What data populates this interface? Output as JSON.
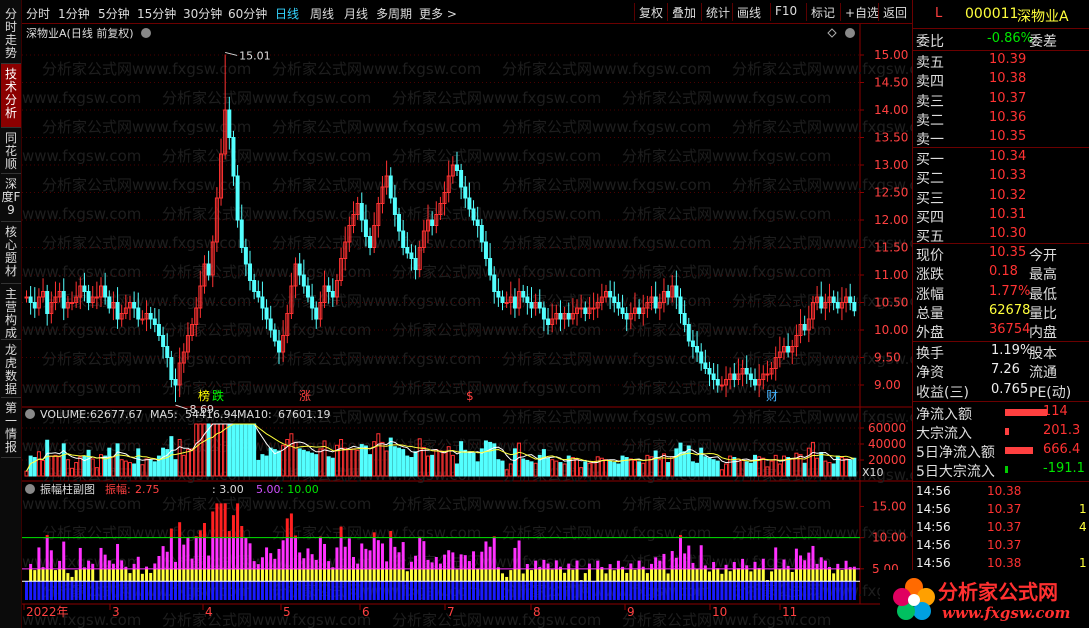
{
  "nav": [
    "分时走势",
    "技术分析",
    "同花顺",
    "深度F9",
    "核心题材",
    "主营构成",
    "龙虎数据",
    "第一情报"
  ],
  "toolbar": {
    "periods": [
      "分时",
      "1分钟",
      "5分钟",
      "15分钟",
      "30分钟",
      "60分钟",
      "日线",
      "周线",
      "月线",
      "多周期",
      "更多 >"
    ],
    "active_period": "日线",
    "right_buttons": [
      "复权",
      "叠加",
      "统计",
      "画线",
      "F10",
      "标记",
      "+自选",
      "返回"
    ]
  },
  "main": {
    "title": "深物业A(日线 前复权)",
    "high_label": "15.01",
    "low_label": "8.69",
    "markers": [
      {
        "text": "榜",
        "color": "#ffff00"
      },
      {
        "text": "跌",
        "color": "#00ff00"
      },
      {
        "text": "涨",
        "color": "#ff4040"
      },
      {
        "text": "$",
        "color": "#ff4040"
      },
      {
        "text": "财",
        "color": "#46b4ff"
      }
    ],
    "y_labels": [
      "15.00",
      "14.50",
      "14.00",
      "13.50",
      "13.00",
      "12.50",
      "12.00",
      "11.50",
      "11.00",
      "10.50",
      "10.00",
      "9.50",
      "9.00"
    ]
  },
  "volume": {
    "label": "VOLUME:",
    "value": "62677.67",
    "ma5_label": "MA5:",
    "ma5": "54416.94",
    "ma10_label": "MA10:",
    "ma10": "67601.19",
    "y_labels": [
      "60000",
      "40000",
      "20000"
    ],
    "unit": "X10"
  },
  "osc": {
    "name": "振幅柱副图",
    "amp_label": "振幅:",
    "amp": "2.75",
    "v1": ": 3.00",
    "v2": "5.00",
    "v3": ": 10.00",
    "y_labels": [
      "15.00",
      "10.00",
      "5.00"
    ]
  },
  "xaxis": [
    "2022年",
    "3",
    "4",
    "5",
    "6",
    "7",
    "8",
    "9",
    "10",
    "11"
  ],
  "watermark": "分析家公式网www.fxgsw.com",
  "quote": {
    "code_prefix": "L",
    "code": "000011",
    "name": "深物业A",
    "weibi_label": "委比",
    "weibi": "-0.86%",
    "weicha_label": "委差",
    "asks": [
      {
        "label": "卖五",
        "price": "10.39"
      },
      {
        "label": "卖四",
        "price": "10.38"
      },
      {
        "label": "卖三",
        "price": "10.37"
      },
      {
        "label": "卖二",
        "price": "10.36"
      },
      {
        "label": "卖一",
        "price": "10.35"
      }
    ],
    "bids": [
      {
        "label": "买一",
        "price": "10.34"
      },
      {
        "label": "买二",
        "price": "10.33"
      },
      {
        "label": "买三",
        "price": "10.32"
      },
      {
        "label": "买四",
        "price": "10.31"
      },
      {
        "label": "买五",
        "price": "10.30"
      }
    ],
    "stats": [
      {
        "l": "现价",
        "v": "10.35",
        "r": "今开",
        "c": "red"
      },
      {
        "l": "涨跌",
        "v": "0.18",
        "r": "最高",
        "c": "red"
      },
      {
        "l": "涨幅",
        "v": "1.77%",
        "r": "最低",
        "c": "red"
      },
      {
        "l": "总量",
        "v": "62678",
        "r": "量比",
        "c": "yellow"
      },
      {
        "l": "外盘",
        "v": "36754",
        "r": "内盘",
        "c": "red"
      }
    ],
    "stats2": [
      {
        "l": "换手",
        "v": "1.19%",
        "r": "股本",
        "c": "white"
      },
      {
        "l": "净资",
        "v": "7.26",
        "r": "流通",
        "c": "white"
      },
      {
        "l": "收益(三)",
        "v": "0.765",
        "r": "PE(动)",
        "c": "white"
      }
    ],
    "flows": [
      {
        "l": "净流入额",
        "v": "114",
        "c": "red",
        "bar": "#ff4040",
        "bw": 42
      },
      {
        "l": "大宗流入",
        "v": "201.3",
        "c": "red",
        "bar": "#ff4040",
        "bw": 4
      },
      {
        "l": "5日净流入额",
        "v": "666.4",
        "c": "red",
        "bar": "#ff4040",
        "bw": 28
      },
      {
        "l": "5日大宗流入",
        "v": "-191.1",
        "c": "green",
        "bar": "#00cc00",
        "bw": 3
      }
    ],
    "ticks": [
      {
        "t": "14:56",
        "p": "10.38",
        "v": ""
      },
      {
        "t": "14:56",
        "p": "10.37",
        "v": "1"
      },
      {
        "t": "14:56",
        "p": "10.37",
        "v": "4"
      },
      {
        "t": "14:56",
        "p": "10.37",
        "v": ""
      },
      {
        "t": "14:56",
        "p": "10.38",
        "v": "1"
      }
    ]
  },
  "logo": {
    "text": "分析家公式网",
    "url": "www.fxgsw.com"
  },
  "colors": {
    "up": "#ff3232",
    "down": "#54ffff",
    "grid": "#4a0000",
    "border": "#8b0000"
  },
  "chart_data": {
    "type": "candlestick",
    "x_range": [
      "2022-02",
      "2022-11"
    ],
    "ylim": [
      8.6,
      15.2
    ],
    "high": 15.01,
    "low": 8.69,
    "closes": [
      10.6,
      10.5,
      10.4,
      10.6,
      10.7,
      10.3,
      10.5,
      10.6,
      10.7,
      10.4,
      10.5,
      10.5,
      10.6,
      10.8,
      10.7,
      10.5,
      10.6,
      10.6,
      10.8,
      10.6,
      10.4,
      10.5,
      10.2,
      10.3,
      10.4,
      10.5,
      10.4,
      10.2,
      10.2,
      10.3,
      10.2,
      10.1,
      9.9,
      9.7,
      9.5,
      9.1,
      9.0,
      9.4,
      9.6,
      9.9,
      10.1,
      10.4,
      10.8,
      11.2,
      11.0,
      11.6,
      12.4,
      13.2,
      14.0,
      13.5,
      12.8,
      12.0,
      11.5,
      11.2,
      10.9,
      10.7,
      10.6,
      10.4,
      10.2,
      10.0,
      9.8,
      9.6,
      9.9,
      10.3,
      10.8,
      11.2,
      11.0,
      10.8,
      10.6,
      10.4,
      10.2,
      10.5,
      10.8,
      10.7,
      10.6,
      10.9,
      11.3,
      11.6,
      11.9,
      12.1,
      12.3,
      12.0,
      11.7,
      11.5,
      11.9,
      12.3,
      12.6,
      12.8,
      12.4,
      12.1,
      11.8,
      11.5,
      11.4,
      11.3,
      11.1,
      11.5,
      11.8,
      12.0,
      11.9,
      12.1,
      12.3,
      12.5,
      12.8,
      13.0,
      12.9,
      12.6,
      12.4,
      12.2,
      12.0,
      11.9,
      11.6,
      11.3,
      11.0,
      10.7,
      10.6,
      10.5,
      10.5,
      10.6,
      10.4,
      10.7,
      10.6,
      10.5,
      10.4,
      10.5,
      10.4,
      10.2,
      10.1,
      10.2,
      10.3,
      10.2,
      10.3,
      10.2,
      10.3,
      10.4,
      10.4,
      10.3,
      10.4,
      10.4,
      10.5,
      10.6,
      10.7,
      10.6,
      10.5,
      10.4,
      10.3,
      10.2,
      10.3,
      10.4,
      10.3,
      10.4,
      10.5,
      10.6,
      10.4,
      10.5,
      10.7,
      10.6,
      10.8,
      10.6,
      10.3,
      10.1,
      9.8,
      9.7,
      9.6,
      9.4,
      9.3,
      9.2,
      9.1,
      9.0,
      9.0,
      9.1,
      9.2,
      9.1,
      9.2,
      9.3,
      9.2,
      9.1,
      9.0,
      9.1,
      9.2,
      9.2,
      9.3,
      9.5,
      9.6,
      9.7,
      9.6,
      9.7,
      9.9,
      10.1,
      10.0,
      10.2,
      10.5,
      10.6,
      10.4,
      10.5,
      10.6,
      10.5,
      10.4,
      10.5,
      10.6,
      10.5,
      10.35
    ],
    "volume_ylim": [
      0,
      70000
    ],
    "osc_ylim": [
      0,
      17
    ]
  }
}
